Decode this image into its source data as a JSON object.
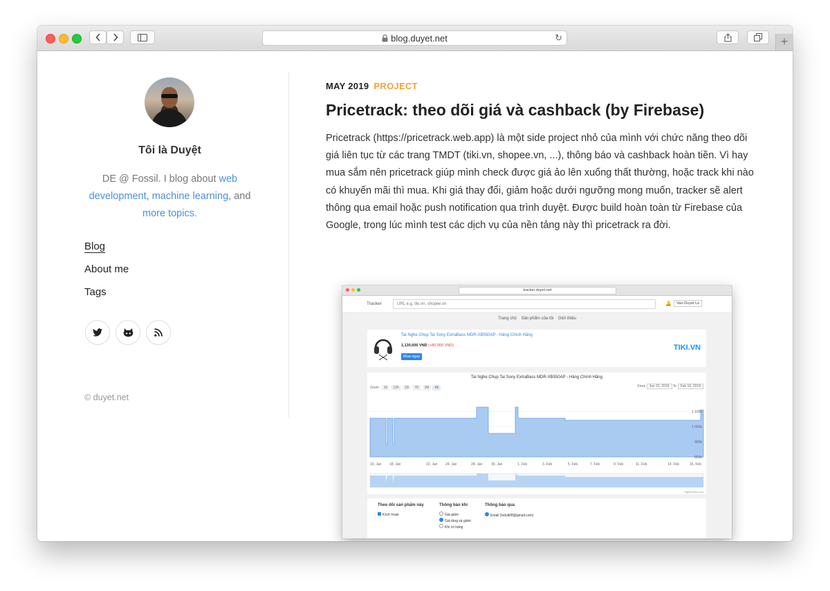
{
  "browser": {
    "url": "blog.duyet.net",
    "back_icon": "chevron-left-icon",
    "forward_icon": "chevron-right-icon",
    "share_icon": "share-icon",
    "tabs_icon": "tabs-icon",
    "new_tab": "+"
  },
  "sidebar": {
    "name": "Tôi là Duyệt",
    "bio_prefix": "DE @ Fossil. I blog about ",
    "bio_link1": "web development",
    "bio_sep": ", ",
    "bio_link2": "machine learning",
    "bio_and": ", and ",
    "bio_link3": "more topics",
    "bio_end": ".",
    "nav": [
      "Blog",
      "About me",
      "Tags"
    ],
    "social": [
      "twitter-icon",
      "github-icon",
      "rss-icon"
    ],
    "copyright": "© duyet.net"
  },
  "post": {
    "date": "MAY 2019",
    "category": "PROJECT",
    "title": "Pricetrack: theo dõi giá và cashback (by Firebase)",
    "body": "Pricetrack (https://pricetrack.web.app) là một side project nhỏ của mình với chức năng theo dõi giá liên tục từ các trang TMDT (tiki.vn, shopee.vn, ...), thông báo và cashback hoàn tiền. Vì hay mua sắm nên pricetrack giúp mình check được giá ảo lên xuống thất thường, hoặc track khi nào có khuyến mãi thì mua. Khi giá thay đổi, giảm hoặc dưới ngưỡng mong muốn, tracker sẽ alert thông qua email hoặc push notification qua trình duyệt. Được build hoàn toàn từ Firebase của Google, trong lúc mình test các dịch vụ của nền tảng này thì pricetrack ra đời."
  },
  "screenshot": {
    "url": "tracker.duyet.net",
    "app_name": "Tracker",
    "search_placeholder": "URL e.g. tiki.vn, shopee.vn",
    "user": "Van-Duyet Le",
    "nav": [
      "Trang chủ",
      "Sản phẩm của tôi",
      "Giới thiệu"
    ],
    "product_title": "Tai Nghe Chụp Tai Sony ExtraBass MDR-XB550AP - Hàng Chính Hãng",
    "price": "1,130,000 VND",
    "price_change": "(+80,000 VND)",
    "buy_label": "Mua ngay",
    "store_logo": "TIKI.VN",
    "chart_title": "Tai Nghe Chụp Tai Sony ExtraBass MDR-XB550AP - Hàng Chính Hãng",
    "zoom_label": "Zoom",
    "zoom_options": [
      "1h",
      "12h",
      "1D",
      "7D",
      "1M",
      "All"
    ],
    "from_label": "From",
    "from_date": "Jan 15, 2019",
    "to_label": "To",
    "to_date": "Feb 16, 2019",
    "y_ticks": [
      "1 100k",
      "1 000k",
      "900k",
      "800k"
    ],
    "x_ticks": [
      "16. Jan",
      "18. Jan",
      "22. Jan",
      "24. Jan",
      "28. Jan",
      "30. Jan",
      "1. Feb",
      "3. Feb",
      "5. Feb",
      "7. Feb",
      "9. Feb",
      "11. Feb",
      "14. Feb",
      "16. Feb"
    ],
    "credits": "Highcharts.com",
    "follow_heading": "Theo dõi sản phẩm này",
    "follow_check": "Kích hoạt",
    "notify_when_heading": "Thông báo khi",
    "notify_when_options": [
      "Giá giảm",
      "Giá tăng và giảm",
      "Khi có hàng"
    ],
    "notify_via_heading": "Thông báo qua",
    "notify_via_option": "Email (lvduit08@gmail.com)"
  }
}
